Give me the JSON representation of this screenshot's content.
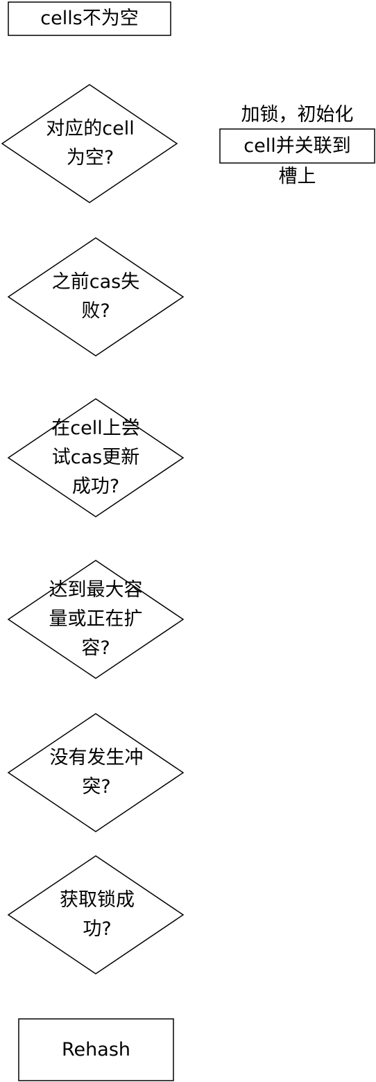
{
  "nodes": {
    "cells_not_empty": "cells不为空",
    "cell_empty_q": "对应的cell为空?",
    "lock_init": {
      "line1": "加锁，初始化",
      "line2": "cell并关联到",
      "line3": "槽上"
    },
    "cas_failed_q": "之前cas失败?",
    "cas_update_q": "在cell上尝试cas更新成功?",
    "capacity_q": "达到最大容量或正在扩容?",
    "no_conflict_q": "没有发生冲突?",
    "lock_success_q": "获取锁成功?",
    "rehash": "Rehash"
  }
}
